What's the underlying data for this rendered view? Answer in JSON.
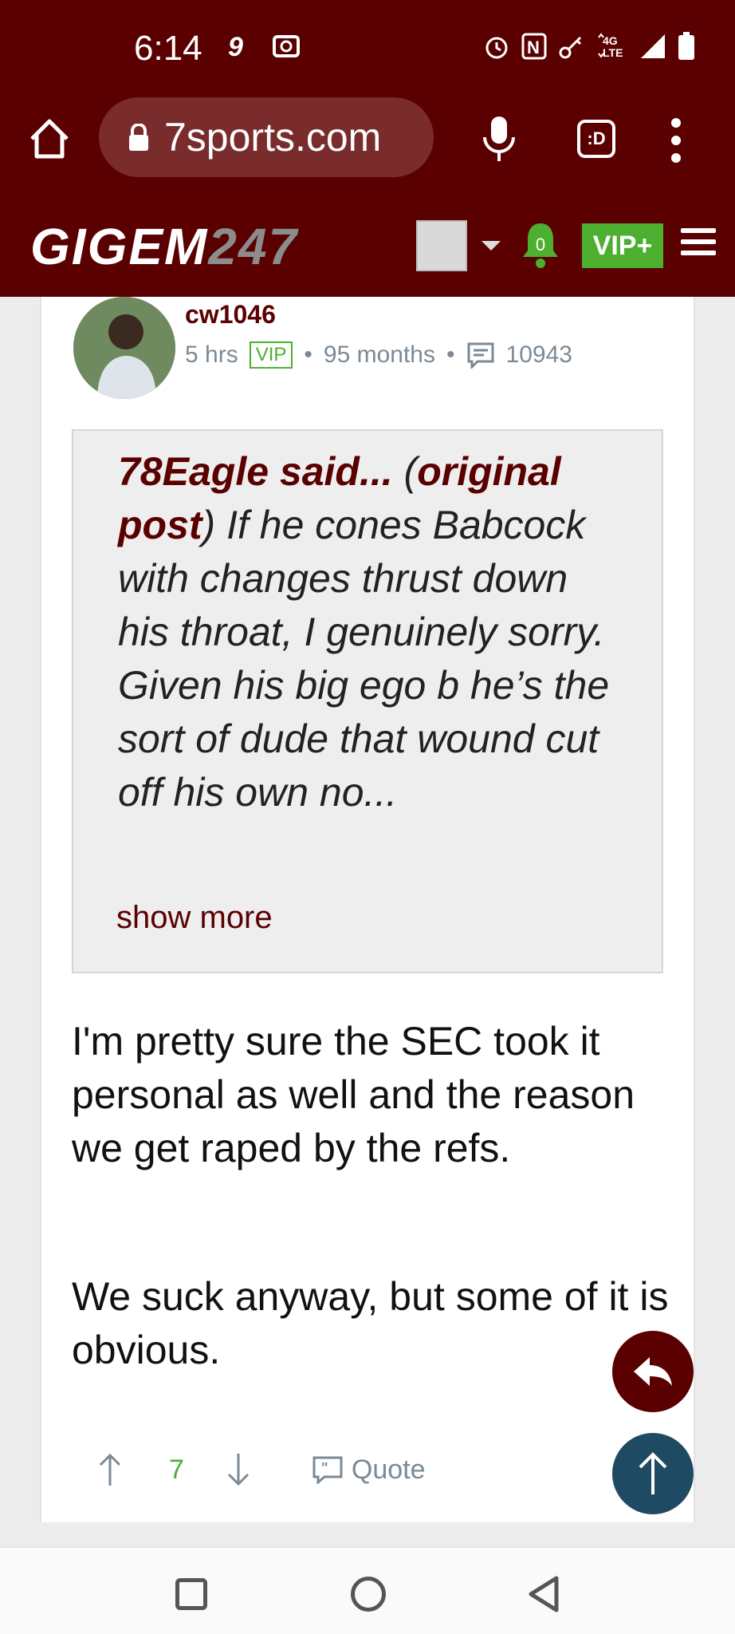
{
  "status": {
    "time": "6:14",
    "left_icons": [
      "facebook-messenger-icon",
      "radio-icon"
    ],
    "right_icons": [
      "alarm-icon",
      "nfc-icon",
      "key-icon",
      "lte-icon",
      "signal-icon",
      "battery-icon"
    ],
    "network": "4G LTE"
  },
  "browser": {
    "url": "7sports.com",
    "tab_label": ":D"
  },
  "site": {
    "logo_text": "GIGEM",
    "logo_number": "247",
    "notification_count": "0",
    "vip_label": "VIP+"
  },
  "post": {
    "username": "cw1046",
    "time_ago": "5 hrs",
    "badge": "VIP",
    "tenure": "95 months",
    "post_count": "10943",
    "quote": {
      "author": "78Eagle said...",
      "source_open": " (",
      "source": "original post",
      "source_close": ")",
      "text": " If he cones Babcock with changes thrust down his throat, I genuinely sorry. Given his big ego b he’s the sort of dude that wound cut off his own no...",
      "show_more": "show more"
    },
    "body": [
      "I'm pretty sure the SEC took it personal as well and the reason we get raped by the refs.",
      "We suck anyway, but some of it is obvious."
    ],
    "likes": "7",
    "quote_label": "Quote"
  },
  "colors": {
    "brand": "#5b0000",
    "vip_green": "#4caf2f",
    "meta_gray": "#7b8a96",
    "scroll_top": "#1f4a63"
  }
}
